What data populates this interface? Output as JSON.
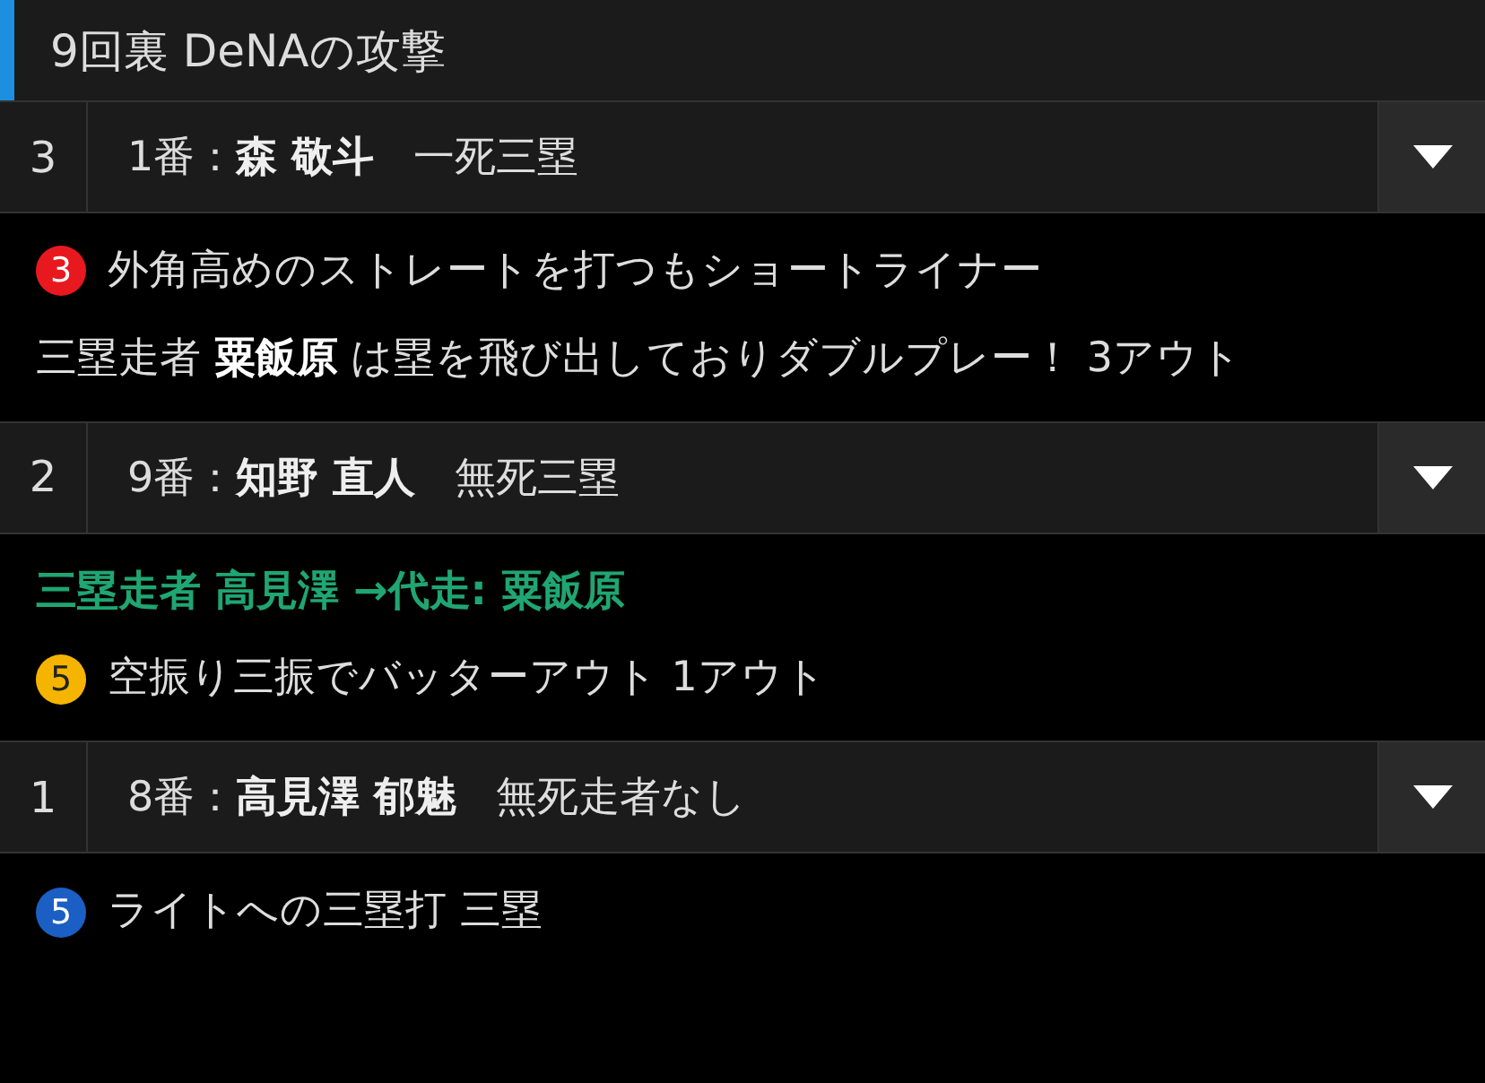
{
  "header": {
    "title": "9回裏 DeNAの攻撃"
  },
  "at_bats": [
    {
      "number": "3",
      "batter": "1番：**森 敬斗**",
      "situation": "一死三塁",
      "expanded": true,
      "events": [
        {
          "kind": "play",
          "badge": "3",
          "color": "#e8191e",
          "text": "外角高めのストレートを打つもショートライナー"
        },
        {
          "kind": "note",
          "text": "三塁走者 **粟飯原** は塁を飛び出しておりダブルプレー！ 3アウト"
        }
      ]
    },
    {
      "number": "2",
      "batter": "9番：**知野 直人**",
      "situation": "無死三塁",
      "expanded": true,
      "events": [
        {
          "kind": "substitution",
          "text": "三塁走者 **高見澤** →代走: **粟飯原**"
        },
        {
          "kind": "play",
          "badge": "5",
          "color": "#f4b400",
          "text": "空振り三振でバッターアウト 1アウト"
        }
      ]
    },
    {
      "number": "1",
      "batter": "8番：**高見澤 郁魅**",
      "situation": "無死走者なし",
      "expanded": true,
      "events": [
        {
          "kind": "play",
          "badge": "5",
          "color": "#1b5fc4",
          "text": "ライトへの三塁打 三塁"
        }
      ]
    }
  ]
}
